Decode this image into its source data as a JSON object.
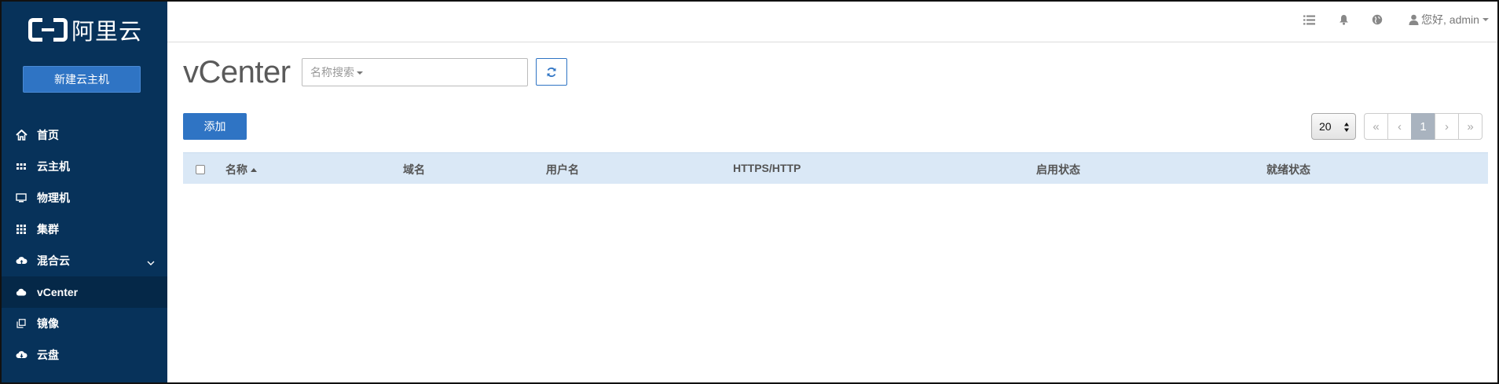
{
  "sidebar": {
    "logo_text": "阿里云",
    "new_vm_label": "新建云主机",
    "items": [
      {
        "label": "首页",
        "icon": "home-icon"
      },
      {
        "label": "云主机",
        "icon": "grid-icon"
      },
      {
        "label": "物理机",
        "icon": "monitor-icon"
      },
      {
        "label": "集群",
        "icon": "grid-large-icon"
      },
      {
        "label": "混合云",
        "icon": "cloud-upload-icon"
      },
      {
        "label": "vCenter",
        "icon": "cloud-icon",
        "active": true
      },
      {
        "label": "镜像",
        "icon": "copy-icon"
      },
      {
        "label": "云盘",
        "icon": "cloud-disk-icon"
      }
    ]
  },
  "header": {
    "user_label": "您好, admin"
  },
  "main": {
    "title": "vCenter",
    "search_placeholder": "名称搜索",
    "add_label": "添加",
    "page_size": "20",
    "pager": [
      "«",
      "‹",
      "1",
      "›",
      "»"
    ],
    "columns": [
      "名称",
      "域名",
      "用户名",
      "HTTPS/HTTP",
      "启用状态",
      "就绪状态"
    ]
  },
  "colors": {
    "sidebar_bg": "#07325a",
    "accent": "#2f74c4",
    "table_header_bg": "#dae8f6"
  }
}
